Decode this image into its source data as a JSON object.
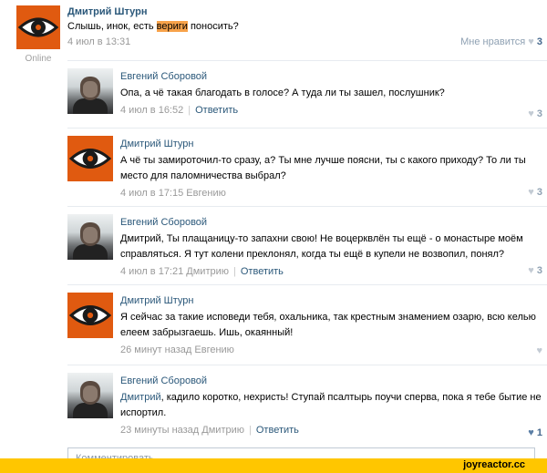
{
  "post": {
    "author": "Дмитрий Штурн",
    "text_before": "Слышь, инок, есть ",
    "text_highlight": "вериги",
    "text_after": " поносить?",
    "date": "4 июл в 13:31",
    "like_label": "Мне нравится",
    "like_count": "3",
    "status": "Online"
  },
  "replies": [
    {
      "author": "Евгений Сборовой",
      "avatar": "photo",
      "mention": "",
      "text": "Опа, а чё такая благодать в голосе? А туда ли ты зашел, послушник?",
      "date": "4 июл в 16:52",
      "addressee": "",
      "reply_label": "Ответить",
      "likes": "3"
    },
    {
      "author": "Дмитрий Штурн",
      "avatar": "eye",
      "mention": "",
      "text": "А чё ты замироточил-то сразу, а? Ты мне лучше поясни, ты с какого приходу? То ли ты место для паломничества выбрал?",
      "date": "4 июл в 17:15",
      "addressee": "Евгению",
      "reply_label": "",
      "likes": "3"
    },
    {
      "author": "Евгений Сборовой",
      "avatar": "photo",
      "mention": "",
      "text": "Дмитрий, Ты плащаницу-то запахни свою! Не воцерквлён ты ещё - о монастыре моём справляться. Я тут колени преклонял, когда ты ещё в купели не возвопил, понял?",
      "date": "4 июл в 17:21",
      "addressee": "Дмитрию",
      "reply_label": "Ответить",
      "likes": "3"
    },
    {
      "author": "Дмитрий Штурн",
      "avatar": "eye",
      "mention": "",
      "text": "Я сейчас за такие исповеди тебя, охальника, так крестным знамением озарю, всю келью елеем забрызгаешь. Ишь, окаянный!",
      "date": "26 минут назад",
      "addressee": "Евгению",
      "reply_label": "",
      "likes": ""
    },
    {
      "author": "Евгений Сборовой",
      "avatar": "photo",
      "mention": "Дмитрий",
      "text": ", кадило коротко, нехристь! Ступай псалтырь поучи сперва, пока я тебе бытие не испортил.",
      "date": "23 минуты назад",
      "addressee": "Дмитрию",
      "reply_label": "Ответить",
      "likes": "1"
    }
  ],
  "comment_placeholder": "Комментировать...",
  "brand": "joyreactor.cc",
  "colors": {
    "avatar_orange": "#e05a10",
    "link_blue": "#2b587a",
    "highlight": "#f7a24a",
    "footer_yellow": "#ffc600"
  }
}
